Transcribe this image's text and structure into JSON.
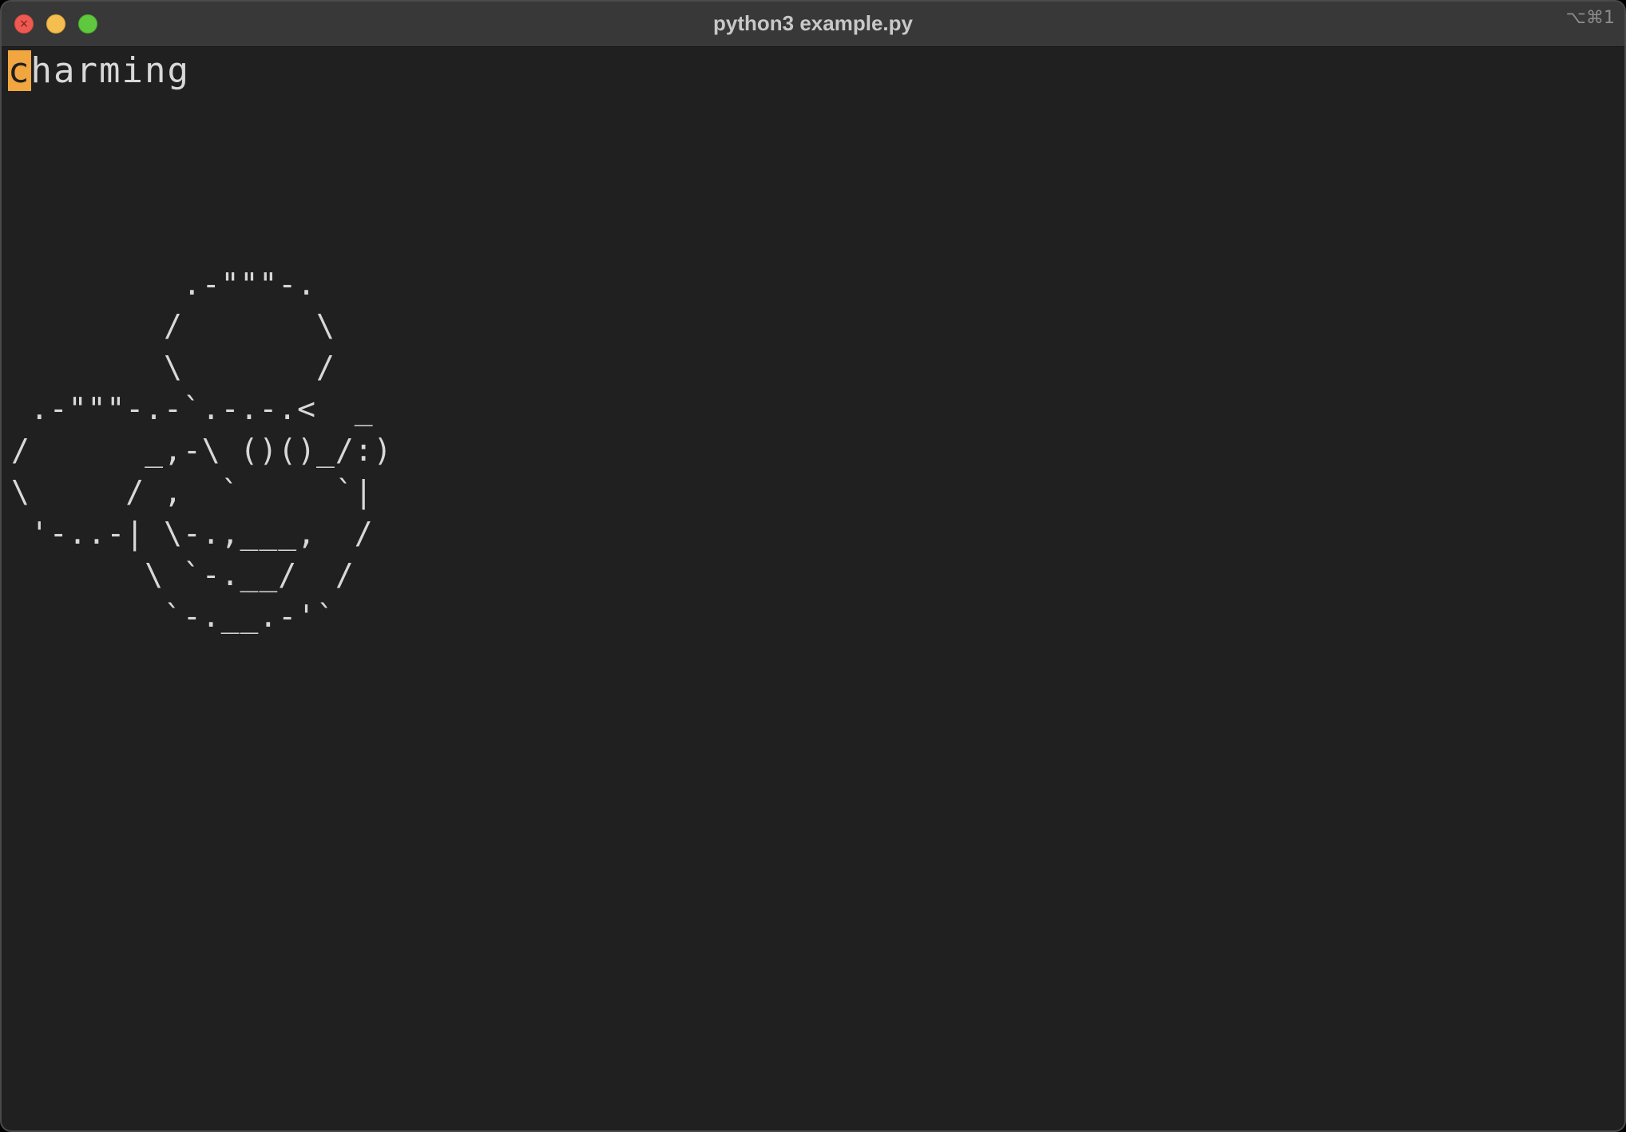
{
  "window": {
    "title": "python3 example.py",
    "shortcut": "⌥⌘1",
    "close_glyph": "×"
  },
  "terminal": {
    "cursor_char": "c",
    "text_after_cursor": "harming",
    "ascii_art": "         .-\"\"\"-.\n        /       \\\n        \\       /\n .-\"\"\"-.-`.-.-.<  _\n/      _,-\\ ()()_/:)\n\\     / ,  `     `|\n '-..-| \\-.,___,  /\n       \\ `-.__/  /\n        `-.__.-'`"
  },
  "colors": {
    "terminal_bg": "#202020",
    "cursor": "#f2a63f",
    "text": "#d8d8d8"
  }
}
